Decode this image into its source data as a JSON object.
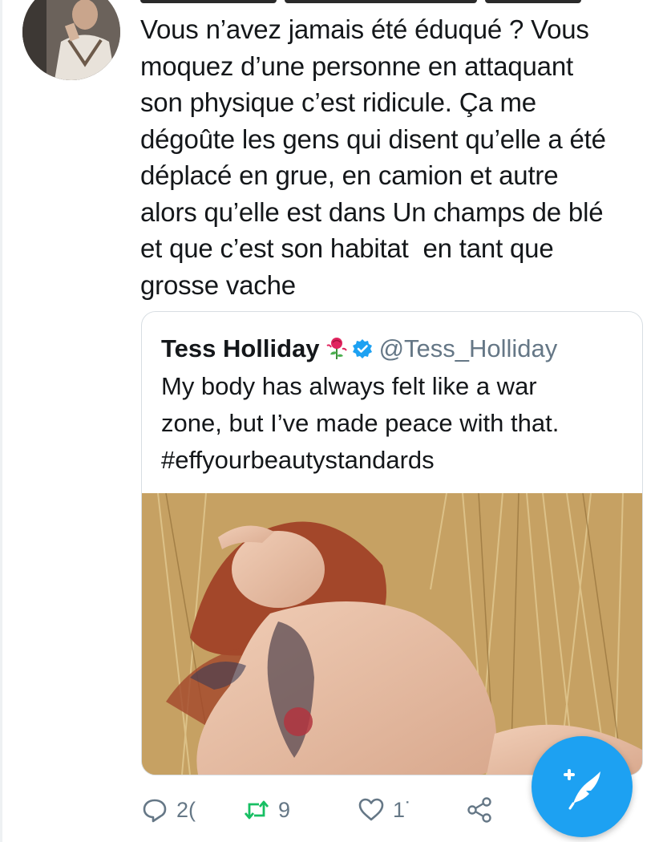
{
  "tweet": {
    "text": "Vous n’avez jamais été éduqué ? Vous\nmoquez d’une personne en attaquant\nson physique c’est ridicule. Ça me\ndégoûte les gens qui disent qu’elle a été\ndéplacé en grue, en camion et autre\nalors qu’elle est dans Un champs de blé\net que c’est son habitat  en tant que\ngrosse vache"
  },
  "quoted_tweet": {
    "name": "Tess Holliday",
    "handle": "@Tess_Holliday",
    "text": "My body has always felt like a war\nzone, but I’ve made peace with that.\n#effyourbeautystandards",
    "rose_icon": "rose-emoji",
    "verified_icon": "verified-badge-icon"
  },
  "actions": {
    "reply_count": "2(",
    "retweet_count": "9",
    "like_count": "1˙"
  },
  "colors": {
    "brand_blue": "#1da1f2",
    "retweet_green": "#17bf63",
    "muted": "#657786",
    "text": "#14171a"
  }
}
